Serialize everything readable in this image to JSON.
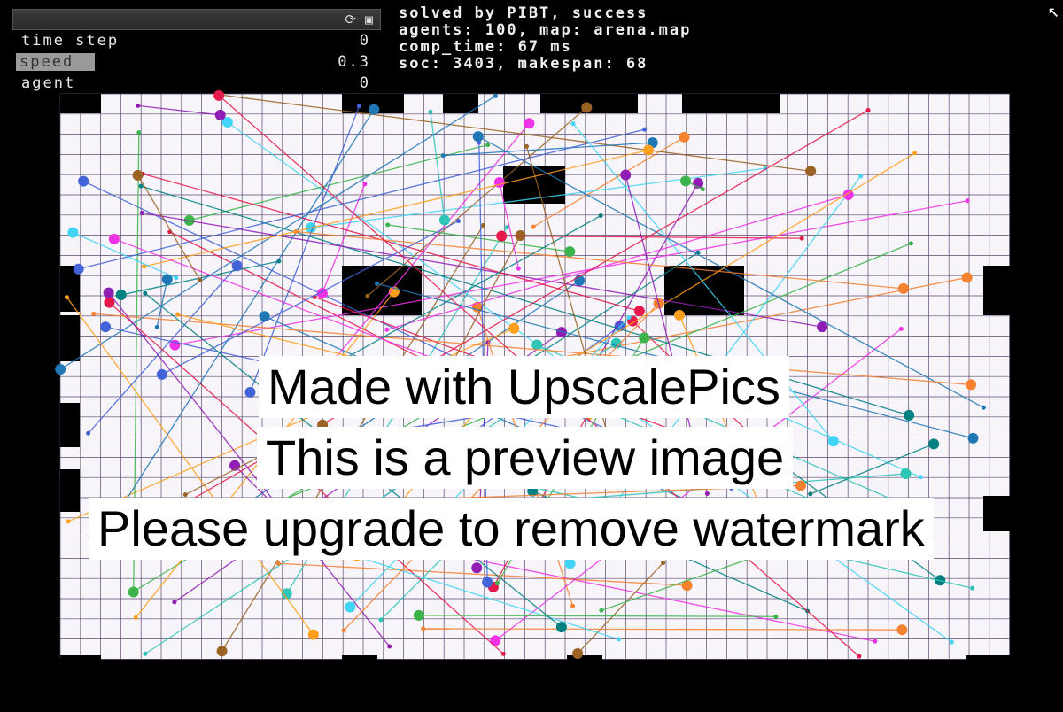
{
  "panel": {
    "icons": [
      "refresh-icon",
      "window-icon"
    ],
    "rows": [
      {
        "label": "time step",
        "value": "0"
      },
      {
        "label": "speed",
        "value": "0.3"
      },
      {
        "label": "agent",
        "value": "0"
      }
    ]
  },
  "info": {
    "line1": "solved by PIBT, success",
    "line2": "agents: 100, map: arena.map",
    "line3": "comp_time: 67 ms",
    "line4": "soc: 3403, makespan: 68"
  },
  "watermark": {
    "line1": "Made with UpscalePics",
    "line2": "This is a preview image",
    "line3": "Please upgrade to remove watermark"
  },
  "colors": {
    "grid_bg": "#f7f4fa",
    "grid_line": "#5b4a6e",
    "obstacle": "#000000",
    "agents": [
      "#e6194b",
      "#3cb44b",
      "#4363d8",
      "#f58231",
      "#911eb4",
      "#42d4f4",
      "#f032e6",
      "#008080",
      "#9a6324",
      "#1f77b4",
      "#ff9f1c",
      "#2ec4b6"
    ]
  },
  "cursor": "cursor-arrow-icon"
}
